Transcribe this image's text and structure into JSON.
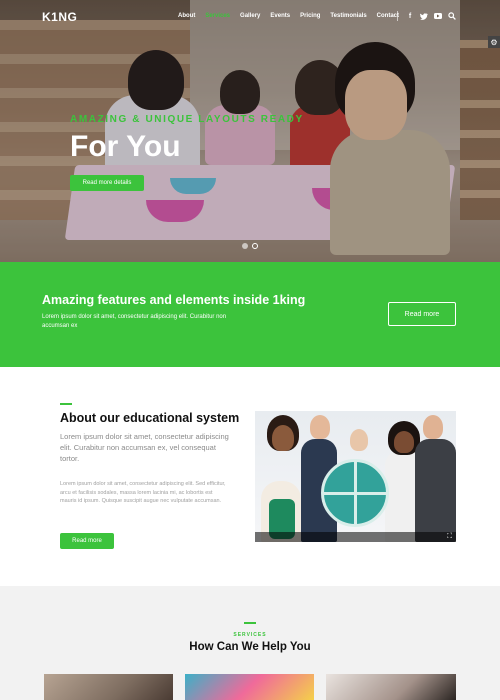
{
  "brand": {
    "logo": "K1NG"
  },
  "nav": {
    "links": [
      "About",
      "Services",
      "Gallery",
      "Events",
      "Pricing",
      "Testimonials",
      "Contact"
    ],
    "active_index": 1,
    "social_icons": [
      "facebook-icon",
      "twitter-icon",
      "youtube-icon",
      "search-icon"
    ]
  },
  "hero": {
    "tagline": "AMAZING & UNIQUE LAYOUTS READY",
    "title": "For You",
    "button": "Read more details",
    "slides": 2,
    "active_slide": 2
  },
  "features_band": {
    "title": "Amazing features and elements inside 1king",
    "text": "Lorem ipsum dolor sit amet, consectetur adipiscing elit. Curabitur non accumsan ex",
    "button": "Read more"
  },
  "about": {
    "title": "About our educational system",
    "lead": "Lorem ipsum dolor sit amet, consectetur adipiscing elit. Curabitur non accumsan ex, vel consequat tortor.",
    "body": "Lorem ipsum dolor sit amet, consectetur adipiscing elit. Sed efficitur, arcu et facilisis sodales, massa lorem lacinia mi, ac lobortis est mauris id ipsum. Quisque suscipit augue nec vulputate accumsan.",
    "button": "Read more"
  },
  "services": {
    "kicker": "SERVICES",
    "title": "How Can We Help You"
  },
  "colors": {
    "accent": "#3cc33c",
    "band": "#3cc33c",
    "services_bg": "#f2f2f2"
  }
}
